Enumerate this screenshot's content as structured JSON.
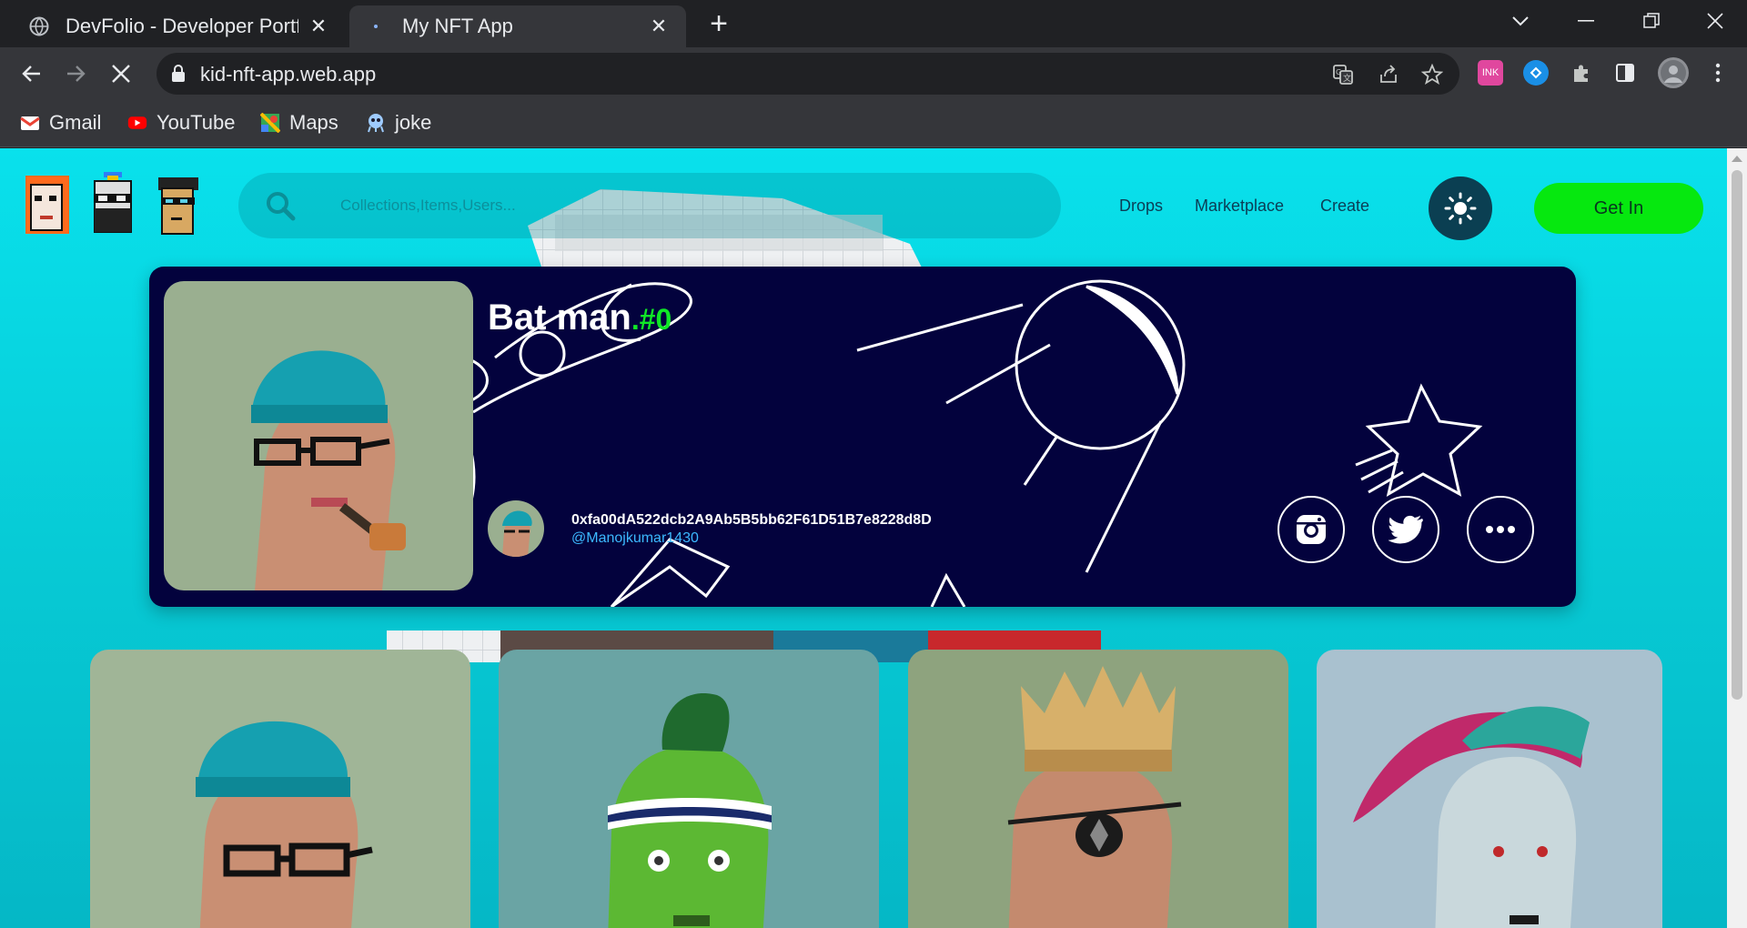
{
  "browser": {
    "tabs": [
      {
        "title": "DevFolio - Developer Portfol",
        "active": false
      },
      {
        "title": "My NFT App",
        "active": true
      }
    ],
    "url": "kid-nft-app.web.app",
    "extension_badge": "INK",
    "bookmarks": [
      {
        "label": "Gmail",
        "icon": "gmail-icon"
      },
      {
        "label": "YouTube",
        "icon": "youtube-icon"
      },
      {
        "label": "Maps",
        "icon": "maps-icon"
      },
      {
        "label": "joke",
        "icon": "joke-icon"
      }
    ]
  },
  "site": {
    "search": {
      "placeholder": "Collections,Items,Users..."
    },
    "nav": {
      "drops": "Drops",
      "marketplace": "Marketplace",
      "create": "Create"
    },
    "theme_toggle_icon": "sun-icon",
    "get_in": "Get In",
    "profile": {
      "name": "Bat man",
      "hash": ".#0",
      "wallet": "0xfa00dA522dcb2A9Ab5B5bb62F61D51B7e8228d8D",
      "handle": "@Manojkumar1430",
      "social": [
        "instagram-icon",
        "twitter-icon",
        "more-icon"
      ]
    },
    "colors": {
      "page_bg": "#09e1ec",
      "card_bg": "#03023d",
      "accent_green": "#06e80f",
      "hash_green": "#10e826",
      "handle_blue": "#3cb9ff"
    }
  }
}
